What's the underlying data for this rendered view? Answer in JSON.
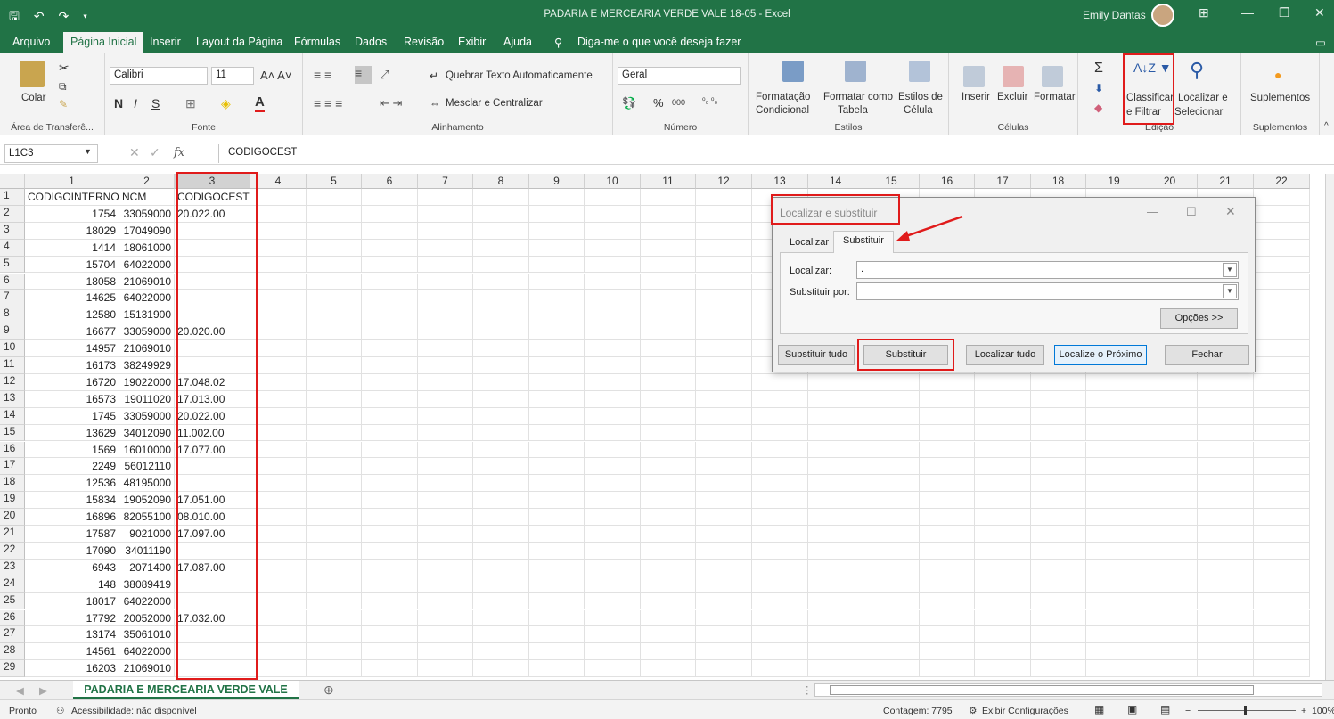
{
  "window": {
    "title": "PADARIA E MERCEARIA VERDE VALE 18-05  -  Excel",
    "user": "Emily Dantas"
  },
  "menu": [
    "Arquivo",
    "Página Inicial",
    "Inserir",
    "Layout da Página",
    "Fórmulas",
    "Dados",
    "Revisão",
    "Exibir",
    "Ajuda"
  ],
  "tellme": "Diga-me o que você deseja fazer",
  "ribbon": {
    "clipboard": {
      "paste": "Colar",
      "label": "Área de Transferê..."
    },
    "font": {
      "name": "Calibri",
      "size": "11",
      "label": "Fonte"
    },
    "alignment": {
      "wrap": "Quebrar Texto Automaticamente",
      "merge": "Mesclar e Centralizar",
      "label": "Alinhamento"
    },
    "number": {
      "format": "Geral",
      "label": "Número"
    },
    "styles": {
      "cond1": "Formatação",
      "cond2": "Condicional",
      "table1": "Formatar como",
      "table2": "Tabela",
      "cell1": "Estilos de",
      "cell2": "Célula",
      "label": "Estilos"
    },
    "cells": {
      "insert": "Inserir",
      "delete": "Excluir",
      "format": "Formatar",
      "label": "Células"
    },
    "editing": {
      "sort1": "Classificar",
      "sort2": "e Filtrar",
      "find1": "Localizar e",
      "find2": "Selecionar",
      "label": "Edição"
    },
    "addins": {
      "name": "Suplementos",
      "label": "Suplementos"
    }
  },
  "formula": {
    "namebox": "L1C3",
    "content": "CODIGOCEST"
  },
  "columns": [
    "1",
    "2",
    "3",
    "4",
    "5",
    "6",
    "7",
    "8",
    "9",
    "10",
    "11",
    "12",
    "13",
    "14",
    "15",
    "16",
    "17",
    "18",
    "19",
    "20",
    "21",
    "22"
  ],
  "rows": [
    {
      "n": "1",
      "a": "CODIGOINTERNO",
      "b": "NCM",
      "c": "CODIGOCEST"
    },
    {
      "n": "2",
      "a": "1754",
      "b": "33059000",
      "c": "20.022.00"
    },
    {
      "n": "3",
      "a": "18029",
      "b": "17049090",
      "c": ""
    },
    {
      "n": "4",
      "a": "1414",
      "b": "18061000",
      "c": ""
    },
    {
      "n": "5",
      "a": "15704",
      "b": "64022000",
      "c": ""
    },
    {
      "n": "6",
      "a": "18058",
      "b": "21069010",
      "c": ""
    },
    {
      "n": "7",
      "a": "14625",
      "b": "64022000",
      "c": ""
    },
    {
      "n": "8",
      "a": "12580",
      "b": "15131900",
      "c": ""
    },
    {
      "n": "9",
      "a": "16677",
      "b": "33059000",
      "c": "20.020.00"
    },
    {
      "n": "10",
      "a": "14957",
      "b": "21069010",
      "c": ""
    },
    {
      "n": "11",
      "a": "16173",
      "b": "38249929",
      "c": ""
    },
    {
      "n": "12",
      "a": "16720",
      "b": "19022000",
      "c": "17.048.02"
    },
    {
      "n": "13",
      "a": "16573",
      "b": "19011020",
      "c": "17.013.00"
    },
    {
      "n": "14",
      "a": "1745",
      "b": "33059000",
      "c": "20.022.00"
    },
    {
      "n": "15",
      "a": "13629",
      "b": "34012090",
      "c": "11.002.00"
    },
    {
      "n": "16",
      "a": "1569",
      "b": "16010000",
      "c": "17.077.00"
    },
    {
      "n": "17",
      "a": "2249",
      "b": "56012110",
      "c": ""
    },
    {
      "n": "18",
      "a": "12536",
      "b": "48195000",
      "c": ""
    },
    {
      "n": "19",
      "a": "15834",
      "b": "19052090",
      "c": "17.051.00"
    },
    {
      "n": "20",
      "a": "16896",
      "b": "82055100",
      "c": "08.010.00"
    },
    {
      "n": "21",
      "a": "17587",
      "b": "9021000",
      "c": "17.097.00"
    },
    {
      "n": "22",
      "a": "17090",
      "b": "34011190",
      "c": ""
    },
    {
      "n": "23",
      "a": "6943",
      "b": "2071400",
      "c": "17.087.00"
    },
    {
      "n": "24",
      "a": "148",
      "b": "38089419",
      "c": ""
    },
    {
      "n": "25",
      "a": "18017",
      "b": "64022000",
      "c": ""
    },
    {
      "n": "26",
      "a": "17792",
      "b": "20052000",
      "c": "17.032.00"
    },
    {
      "n": "27",
      "a": "13174",
      "b": "35061010",
      "c": ""
    },
    {
      "n": "28",
      "a": "14561",
      "b": "64022000",
      "c": ""
    },
    {
      "n": "29",
      "a": "16203",
      "b": "21069010",
      "c": ""
    }
  ],
  "dialog": {
    "title": "Localizar e substituir",
    "tab_find": "Localizar",
    "tab_replace": "Substituir",
    "find_label": "Localizar:",
    "find_value": ".",
    "replace_label": "Substituir por:",
    "replace_value": "",
    "options": "Opções >>",
    "replace_all": "Substituir tudo",
    "replace": "Substituir",
    "find_all": "Localizar tudo",
    "find_next": "Localize o Próximo",
    "close": "Fechar"
  },
  "sheet_tab": "PADARIA E MERCEARIA VERDE VALE",
  "status": {
    "ready": "Pronto",
    "accessibility": "Acessibilidade: não disponível",
    "count": "Contagem: 7795",
    "display": "Exibir Configurações",
    "zoom": "100%"
  },
  "colors": {
    "excel_green": "#217346",
    "highlight": "#e01b1b"
  }
}
